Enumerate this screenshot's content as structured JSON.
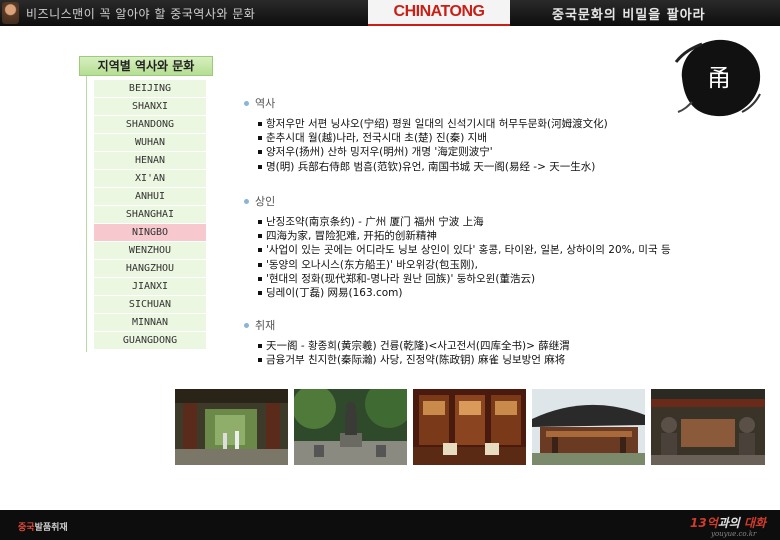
{
  "header": {
    "slogan": "비즈니스맨이 꼭 알아야 할 중국역사와 문화",
    "logo": "CHINATONG",
    "tagline": "중국문화의 비밀을 팔아라",
    "seal_char": "甬"
  },
  "sidebar": {
    "title": "지역별 역사와 문화",
    "items": [
      {
        "label": "BEIJING"
      },
      {
        "label": "SHANXI"
      },
      {
        "label": "SHANDONG"
      },
      {
        "label": "WUHAN"
      },
      {
        "label": "HENAN"
      },
      {
        "label": "XI'AN"
      },
      {
        "label": "ANHUI"
      },
      {
        "label": "SHANGHAI"
      },
      {
        "label": "NINGBO",
        "active": true
      },
      {
        "label": "WENZHOU"
      },
      {
        "label": "HANGZHOU"
      },
      {
        "label": "JIANXI"
      },
      {
        "label": "SICHUAN"
      },
      {
        "label": "MINNAN"
      },
      {
        "label": "GUANGDONG"
      }
    ]
  },
  "sections": [
    {
      "title": "역사",
      "items": [
        "항저우만 서편 닝샤오(宁绍) 평원 일대의 신석기시대 허무두문화(河姆渡文化)",
        "춘추시대 월(越)나라, 전국시대 초(楚) 진(秦) 지배",
        "양저우(扬州) 산하 밍저우(明州) 개명 '海定则波宁'",
        "명(明) 兵部右侍郎 범흠(范钦)유언, 南国书城 天一阁(易经 -> 天一生水)"
      ]
    },
    {
      "title": "상인",
      "items": [
        "난징조약(南京条约) - 广州 厦门 福州 宁波 上海",
        "四海为家, 冒险犯难, 开拓的创新精神",
        "'사업이 있는 곳에는 어디라도 닝보 상인이 있다' 홍콩, 타이완, 일본, 상하이의 20%, 미국 등",
        "'동양의 오나시스(东方船王)' 바오위강(包玉刚),",
        "'현대의 정화(现代郑和-명나라 원난 回族)' 둥하오윈(董浩云)",
        "딩레이(丁磊) 网易(163.com)"
      ]
    },
    {
      "title": "취재",
      "items": [
        "天一阁 - 황종희(黄宗羲) 건륭(乾隆)<사고전서(四库全书)> 薛继渭",
        "금융거부 친지한(秦际瀚) 사당, 진정약(陈政钥) 麻雀 닝보방언 麻将"
      ]
    }
  ],
  "footer": {
    "left_red": "중국",
    "left_rest": "발품취재",
    "right_red": "13억",
    "right_mid": "과의 ",
    "right_end": "대화",
    "url": "youyue.co.kr"
  },
  "colors": {
    "brand_red": "#c91f16",
    "sidebar_green": "#ecf7e1",
    "sidebar_active": "#f7c9cf",
    "section_bullet": "#8bb4d6"
  }
}
